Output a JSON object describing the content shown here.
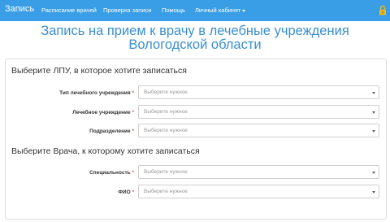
{
  "navbar": {
    "brand": "Запись",
    "items": [
      "Расписание врачей",
      "Проверка записи",
      "Помощь",
      "Личный кабинет"
    ]
  },
  "page_title": "Запись на прием к врачу в лечебные учреждения Вологодской области",
  "sections": {
    "lpu": {
      "heading": "Выберите ЛПУ, в которое хотите записаться",
      "fields": [
        {
          "label": "Тип лечебного учреждения",
          "required": "*",
          "value": "Выберите нужное"
        },
        {
          "label": "Лечебное учреждение",
          "required": "*",
          "value": "Выберите нужное"
        },
        {
          "label": "Подразделение",
          "required": "*",
          "value": "Выберите нужное"
        }
      ]
    },
    "doctor": {
      "heading": "Выберите Врача, к которому хотите записаться",
      "fields": [
        {
          "label": "Специальность",
          "required": "*",
          "value": "Выберите нужное"
        },
        {
          "label": "ФИО",
          "required": "*",
          "value": "Выберите нужное"
        }
      ]
    }
  },
  "colors": {
    "navbar": "#3a9ee6",
    "title": "#3a8fd0",
    "required": "#d9534f",
    "lock": "#e8b923"
  },
  "icons": [
    "lock-icon",
    "chevron-down-icon"
  ]
}
